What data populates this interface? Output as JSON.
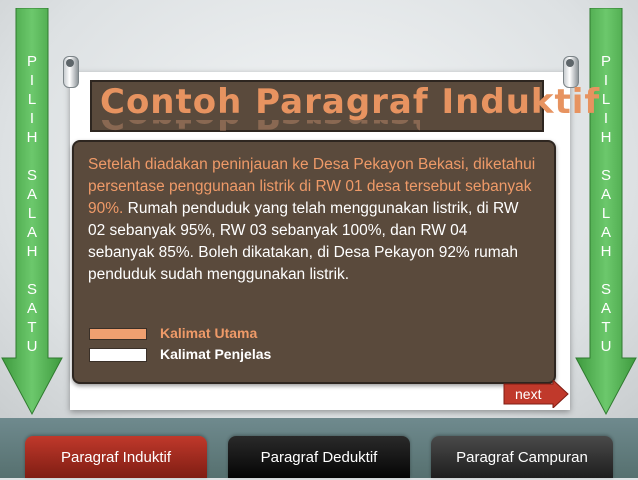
{
  "side_arrows": {
    "left_letters": [
      "P",
      "I",
      "L",
      "I",
      "H",
      "",
      "S",
      "A",
      "L",
      "A",
      "H",
      "",
      "S",
      "A",
      "T",
      "U"
    ],
    "right_letters": [
      "P",
      "I",
      "L",
      "I",
      "H",
      "",
      "S",
      "A",
      "L",
      "A",
      "H",
      "",
      "S",
      "A",
      "T",
      "U"
    ],
    "color": "#5cb85c"
  },
  "slide": {
    "title": "Contoh Paragraf Induktif",
    "paragraph_main": "Setelah diadakan peninjauan ke Desa Pekayon Bekasi, diketahui persentase penggunaan listrik di RW 01 desa tersebut sebanyak 90%.",
    "paragraph_rest": " Rumah penduduk yang telah menggunakan listrik, di RW 02 sebanyak 95%, RW 03 sebanyak 100%, dan RW 04 sebanyak 85%. Boleh dikatakan, di Desa Pekayon 92% rumah penduduk sudah menggunakan listrik.",
    "legend": {
      "main_label": "Kalimat Utama",
      "support_label": "Kalimat Penjelas"
    },
    "next_label": "next"
  },
  "tabs": [
    {
      "label": "Paragraf Induktif"
    },
    {
      "label": "Paragraf Deduktif"
    },
    {
      "label": "Paragraf Campuran"
    }
  ],
  "colors": {
    "accent_orange": "#ef9a68",
    "panel_brown": "#5a4a3c",
    "tab_red": "#c0392b"
  }
}
